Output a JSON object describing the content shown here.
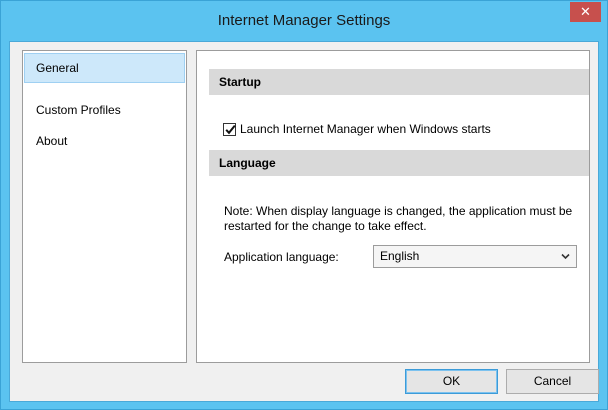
{
  "window": {
    "title": "Internet Manager Settings",
    "close_glyph": "✕"
  },
  "sidebar": {
    "items": [
      {
        "label": "General",
        "selected": true
      },
      {
        "label": "Custom Profiles",
        "selected": false
      },
      {
        "label": "About",
        "selected": false
      }
    ]
  },
  "general": {
    "startup_header": "Startup",
    "launch_checkbox": {
      "label": "Launch Internet Manager when Windows starts",
      "checked": true
    },
    "language_header": "Language",
    "note": "Note: When display language is changed, the application must be restarted for the change to take effect.",
    "language_label": "Application language:",
    "language_value": "English"
  },
  "buttons": {
    "ok": "OK",
    "cancel": "Cancel"
  },
  "colors": {
    "frame": "#5bc3f0",
    "close_button": "#c7504d",
    "selection": "#cde8fa",
    "section_header": "#d9d9d9"
  },
  "icons": {
    "close": "close-icon",
    "check": "checkmark-icon",
    "dropdown": "chevron-down-icon"
  }
}
